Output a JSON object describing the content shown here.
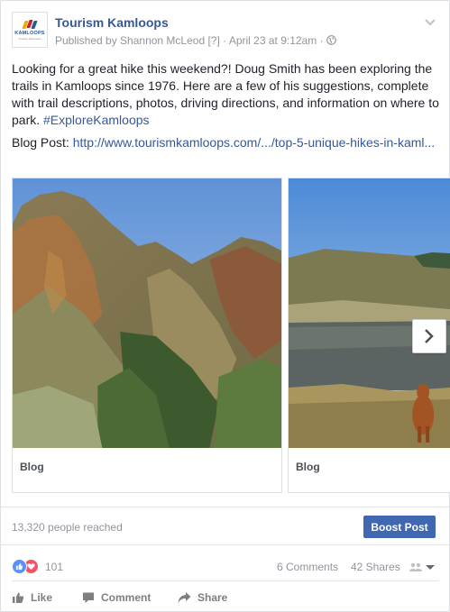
{
  "post": {
    "page_name": "Tourism Kamloops",
    "avatar_brand": "KAMLOOPS",
    "avatar_tagline": "Tourism Kamloops",
    "published_by": "Published by Shannon McLeod",
    "help_marker": "[?]",
    "date": "April 23 at 9:12am",
    "separator": "·",
    "body_text": "Looking for a great hike this weekend?! Doug Smith has been exploring the trails in Kamloops since 1976. Here are a few of his suggestions, complete with trail descriptions, photos, driving directions, and information on where to park.",
    "hashtag": "#ExploreKamloops",
    "blog_label": "Blog Post:",
    "blog_link": "http://www.tourismkamloops.com/.../top-5-unique-hikes-in-kaml..."
  },
  "carousel": [
    {
      "caption": "Blog"
    },
    {
      "caption": "Blog"
    }
  ],
  "insights": {
    "reach": "13,320 people reached",
    "boost_label": "Boost Post"
  },
  "stats": {
    "reaction_count": "101",
    "comments": "6 Comments",
    "shares": "42 Shares"
  },
  "actions": {
    "like": "Like",
    "comment": "Comment",
    "share": "Share"
  },
  "colors": {
    "link": "#365899",
    "boost": "#4267b2",
    "like_reaction": "#5890ff",
    "love_reaction": "#f25268"
  }
}
